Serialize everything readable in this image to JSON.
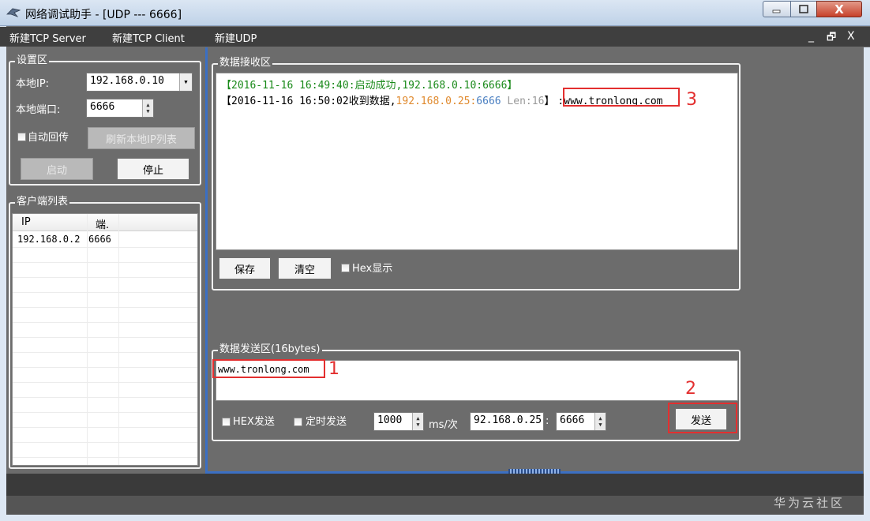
{
  "window": {
    "title": "网络调试助手 - [UDP --- 6666]",
    "controls": {
      "minimize": "_",
      "maximize": "□",
      "close": "X"
    }
  },
  "menu": {
    "items": [
      "新建TCP Server",
      "新建TCP Client",
      "新建UDP"
    ],
    "mdi_controls": [
      "_",
      "🗗",
      "X"
    ]
  },
  "settings": {
    "group_title": "设置区",
    "local_ip_label": "本地IP:",
    "local_ip_value": "192.168.0.10",
    "local_port_label": "本地端口:",
    "local_port_value": "6666",
    "auto_reply_label": "自动回传",
    "refresh_ip_button": "刷新本地IP列表",
    "start_button": "启动",
    "stop_button": "停止"
  },
  "clients": {
    "group_title": "客户端列表",
    "columns": [
      "IP",
      "端."
    ],
    "rows": [
      {
        "ip": "192.168.0.2",
        "port": "6666"
      }
    ]
  },
  "receive": {
    "group_title": "数据接收区",
    "log": [
      {
        "text": "【2016-11-16 16:49:40:启动成功,192.168.0.10:6666】"
      },
      {
        "prefix": "【2016-11-16 16:50:02收到数据,",
        "addr": "192.168.0.25:",
        "port": "6666",
        "len": " Len:16",
        "close": "】",
        "payload": ":www.tronlong.com"
      }
    ],
    "save_button": "保存",
    "clear_button": "清空",
    "hex_display_label": "Hex显示"
  },
  "send": {
    "group_title": "数据发送区(16bytes)",
    "content": "www.tronlong.com",
    "hex_send_label": "HEX发送",
    "timed_send_label": "定时发送",
    "interval_value": "1000",
    "interval_unit": "ms/次",
    "target_ip": "92.168.0.25",
    "separator": ":",
    "target_port": "6666",
    "send_button": "发送"
  },
  "annotations": [
    "1",
    "2",
    "3"
  ],
  "watermark": "华为云社区",
  "colors": {
    "log_green": "#1a8a1a",
    "log_orange": "#e08a2e",
    "log_blue": "#4a7fc1",
    "log_gray": "#9a9a9a",
    "annotation_red": "#e32f2f",
    "splitter_blue": "#3b6fc3"
  }
}
